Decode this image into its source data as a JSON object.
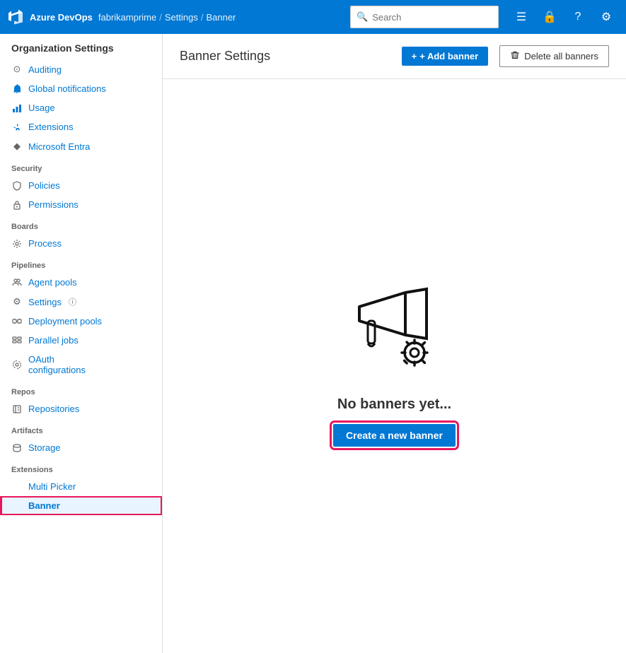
{
  "topNav": {
    "logoText": "Azure DevOps",
    "org": "fabrikamprime",
    "sep1": "/",
    "section": "Settings",
    "sep2": "/",
    "page": "Banner",
    "searchPlaceholder": "Search",
    "icons": [
      "list-icon",
      "lock-icon",
      "help-icon",
      "user-icon"
    ]
  },
  "sidebar": {
    "title": "Organization Settings",
    "sections": [
      {
        "header": "",
        "items": [
          {
            "id": "auditing",
            "label": "Auditing",
            "icon": "⊙"
          },
          {
            "id": "global-notifications",
            "label": "Global notifications",
            "icon": "🔔"
          },
          {
            "id": "usage",
            "label": "Usage",
            "icon": "📊"
          },
          {
            "id": "extensions",
            "label": "Extensions",
            "icon": "🧩"
          },
          {
            "id": "microsoft-entra",
            "label": "Microsoft Entra",
            "icon": "◆"
          }
        ]
      },
      {
        "header": "Security",
        "items": [
          {
            "id": "policies",
            "label": "Policies",
            "icon": "🔒"
          },
          {
            "id": "permissions",
            "label": "Permissions",
            "icon": "🔑"
          }
        ]
      },
      {
        "header": "Boards",
        "items": [
          {
            "id": "process",
            "label": "Process",
            "icon": "⚙"
          }
        ]
      },
      {
        "header": "Pipelines",
        "items": [
          {
            "id": "agent-pools",
            "label": "Agent pools",
            "icon": "👤"
          },
          {
            "id": "settings",
            "label": "Settings",
            "icon": "⚙",
            "badge": "ⓘ"
          },
          {
            "id": "deployment-pools",
            "label": "Deployment pools",
            "icon": "⊞"
          },
          {
            "id": "parallel-jobs",
            "label": "Parallel jobs",
            "icon": "▥"
          },
          {
            "id": "oauth-configurations",
            "label": "OAuth configurations",
            "icon": "🔑"
          }
        ]
      },
      {
        "header": "Repos",
        "items": [
          {
            "id": "repositories",
            "label": "Repositories",
            "icon": "🗂"
          }
        ]
      },
      {
        "header": "Artifacts",
        "items": [
          {
            "id": "storage",
            "label": "Storage",
            "icon": "📦"
          }
        ]
      },
      {
        "header": "Extensions",
        "items": [
          {
            "id": "multi-picker",
            "label": "Multi Picker",
            "icon": ""
          },
          {
            "id": "banner",
            "label": "Banner",
            "icon": "",
            "active": true
          }
        ]
      }
    ]
  },
  "content": {
    "title": "Banner Settings",
    "addBannerLabel": "+ Add banner",
    "deleteAllBannersLabel": "Delete all banners",
    "emptyState": {
      "title": "No banners yet...",
      "createButtonLabel": "Create a new banner"
    }
  }
}
